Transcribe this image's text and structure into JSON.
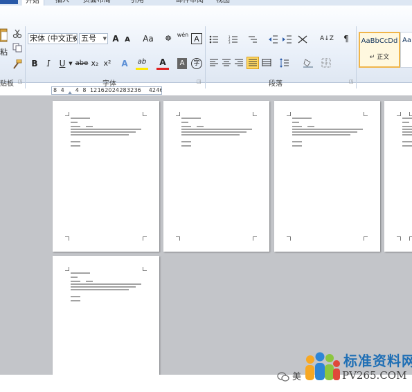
{
  "tabs": [
    {
      "label": "开始",
      "active": true
    },
    {
      "label": "插入",
      "active": false
    },
    {
      "label": "页面布局",
      "active": false
    },
    {
      "label": "引用",
      "active": false
    },
    {
      "label": "邮件",
      "active": false
    },
    {
      "label": "审阅",
      "active": false
    },
    {
      "label": "视图",
      "active": false
    }
  ],
  "clipboard": {
    "paste_label": "粘",
    "group_label": "贴板"
  },
  "font": {
    "font_name": "宋体 (中文正文)",
    "font_size": "五号",
    "grow_label": "A",
    "shrink_label": "A",
    "case_label": "Aa",
    "pinyin_label": "wén",
    "border_char_label": "A",
    "bold_label": "B",
    "italic_label": "I",
    "underline_label": "U",
    "strike_label": "abe",
    "subscript_label": "x₂",
    "superscript_label": "x²",
    "effects_label": "A",
    "highlight_label": "ab",
    "font_color_label": "A",
    "shade_label": "A",
    "enclose_label": "字",
    "group_label": "字体"
  },
  "paragraph": {
    "group_label": "段落",
    "sort_label": "A↓Z"
  },
  "styles": [
    {
      "sample": "AaBbCcDd",
      "name": "↵ 正文",
      "selected": true
    },
    {
      "sample": "AaBb",
      "name": "",
      "selected": false
    }
  ],
  "ruler": {
    "ticks": [
      "8",
      "4",
      "",
      "4",
      "8",
      "12",
      "16",
      "20",
      "24",
      "28",
      "32",
      "36",
      "",
      "42",
      "46"
    ]
  },
  "colors": {
    "highlight": "#ffe800",
    "font_color": "#e02020",
    "accent": "#2a5aa8",
    "workspace": "#c3c5c9"
  },
  "pages": [
    1,
    2,
    3,
    4,
    5
  ],
  "watermark": {
    "name": "美",
    "title": "标准资料网",
    "url": "PV265.COM"
  }
}
